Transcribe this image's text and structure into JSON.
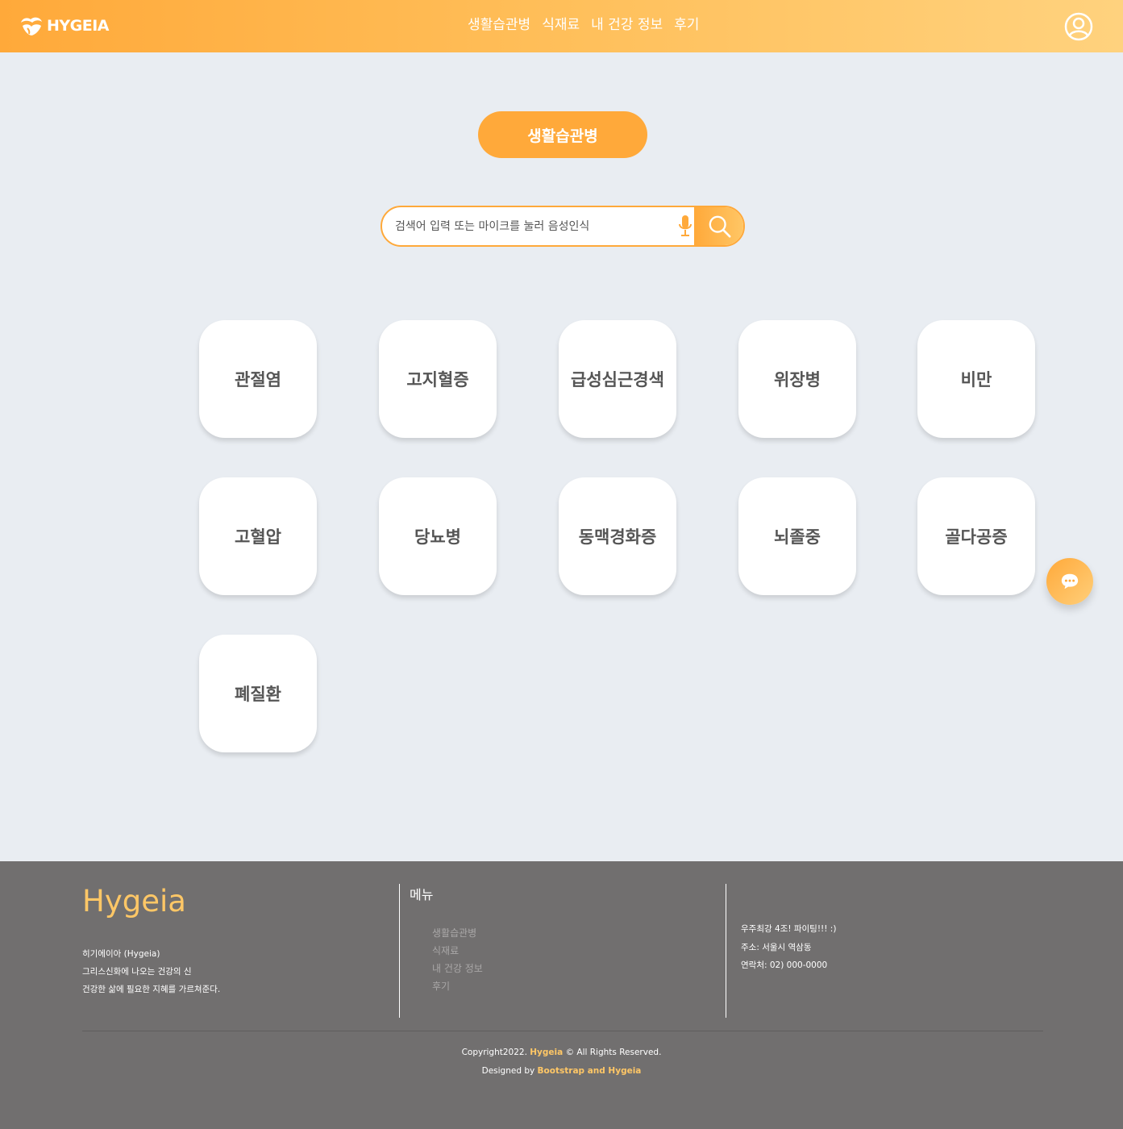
{
  "header": {
    "logo_text": "HYGEIA",
    "nav": [
      "생활습관병",
      "식재료",
      "내 건강 정보",
      "후기"
    ]
  },
  "category_pill": "생활습관병",
  "search": {
    "placeholder": "검색어 입력 또는 마이크를 눌러 음성인식"
  },
  "diseases": [
    "관절염",
    "고지혈증",
    "급성심근경색",
    "위장병",
    "비만",
    "고혈압",
    "당뇨병",
    "동맥경화증",
    "뇌졸중",
    "골다공증",
    "폐질환"
  ],
  "footer": {
    "brand": "Hygeia",
    "about": [
      "히기에이아 (Hygeia)",
      "그리스신화에 나오는 건강의 신",
      "건강한 삶에 필요한 지혜를 가르쳐준다."
    ],
    "menu_title": "메뉴",
    "menu": [
      "생활습관병",
      "식재료",
      "내 건강 정보",
      "후기"
    ],
    "contact": [
      "우주최강 4조! 파이팅!!! :)",
      "주소: 서울시 역삼동",
      "연락처: 02) 000-0000"
    ],
    "copyright_prefix": "Copyright2022. ",
    "copyright_brand": "Hygeia",
    "copyright_suffix": " © All Rights Reserved.",
    "designed_prefix": "Designed by ",
    "designed_by": "Bootstrap and Hygeia"
  },
  "colors": {
    "accent": "#ffa93a",
    "accent_light": "#ffd27e",
    "background": "#e9edf2",
    "footer_bg": "#716f6f",
    "footer_brand": "#ffc766"
  },
  "icons": {
    "logo": "hygeia-logo-icon",
    "user": "user-circle-icon",
    "mic": "microphone-icon",
    "search": "search-icon",
    "chat": "chat-bubble-icon"
  }
}
